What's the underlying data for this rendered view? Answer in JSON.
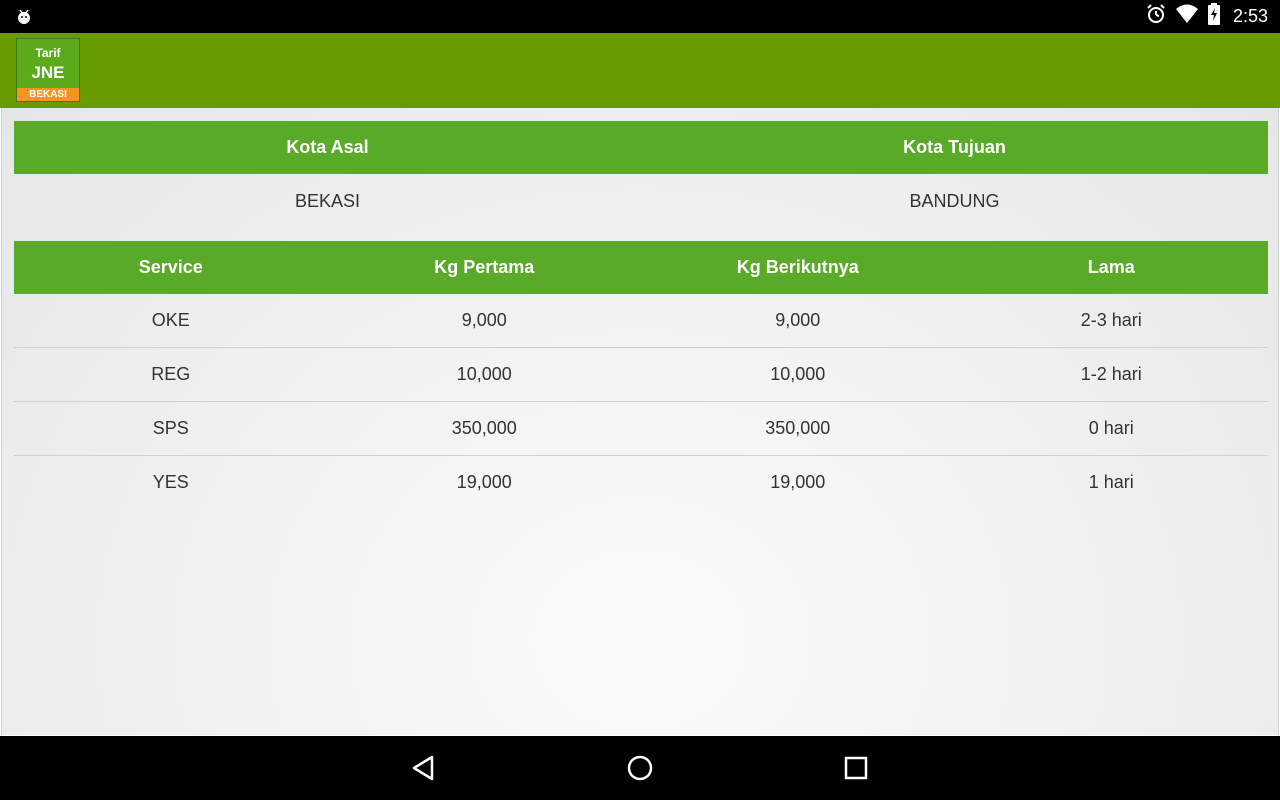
{
  "status_bar": {
    "time": "2:53",
    "icons": [
      "android-debug-icon",
      "alarm-icon",
      "wifi-icon",
      "battery-charging-icon"
    ]
  },
  "app_bar": {
    "logo": {
      "line1": "Tarif",
      "line2": "JNE",
      "line3": "BEKASI"
    }
  },
  "route": {
    "headers": [
      "Kota Asal",
      "Kota Tujuan"
    ],
    "origin": "BEKASI",
    "destination": "BANDUNG"
  },
  "tarif_table": {
    "columns": [
      "Service",
      "Kg Pertama",
      "Kg Berikutnya",
      "Lama"
    ],
    "rows": [
      [
        "OKE",
        "9,000",
        "9,000",
        "2-3 hari"
      ],
      [
        "REG",
        "10,000",
        "10,000",
        "1-2 hari"
      ],
      [
        "SPS",
        "350,000",
        "350,000",
        "0 hari"
      ],
      [
        "YES",
        "19,000",
        "19,000",
        "1 hari"
      ]
    ]
  },
  "colors": {
    "app_bar": "#669c00",
    "table_header": "#5aaa29",
    "logo_badge": "#f7941d"
  },
  "nav_bar": {
    "buttons": [
      "back-icon",
      "home-icon",
      "recents-icon"
    ]
  }
}
